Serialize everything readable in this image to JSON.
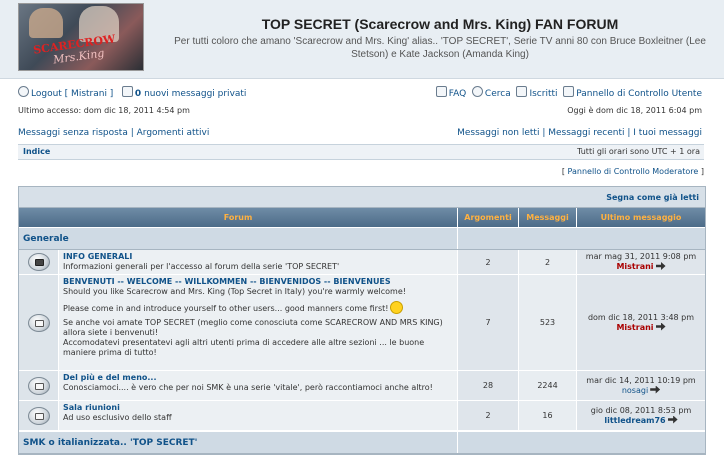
{
  "header": {
    "title": "TOP SECRET (Scarecrow and Mrs. King) FAN FORUM",
    "description": "Per tutti coloro che amano 'Scarecrow and Mrs. King' alias.. 'TOP SECRET', Serie TV anni 80 con Bruce Boxleitner (Lee Stetson) e Kate Jackson (Amanda King)",
    "logo_text_1": "SCARECROW",
    "logo_text_2": "Mrs.King"
  },
  "userbar": {
    "logout": "Logout [ Mistrani ]",
    "pm_count": "0",
    "pm_label": "nuovi messaggi privati",
    "faq": "FAQ",
    "search": "Cerca",
    "members": "Iscritti",
    "ucp": "Pannello di Controllo Utente",
    "last_visit": "Ultimo accesso: dom dic 18, 2011 4:54 pm",
    "current_time": "Oggi è dom dic 18, 2011 6:04 pm"
  },
  "quicklinks": {
    "unanswered": "Messaggi senza risposta",
    "active": "Argomenti attivi",
    "unread": "Messaggi non letti",
    "new": "Messaggi recenti",
    "own": "I tuoi messaggi"
  },
  "navbar": {
    "index": "Indice",
    "timezone": "Tutti gli orari sono UTC + 1 ora"
  },
  "mcp_link": "Pannello di Controllo Moderatore",
  "table": {
    "mark_read": "Segna come già letti",
    "col_forum": "Forum",
    "col_topics": "Argomenti",
    "col_posts": "Messaggi",
    "col_last": "Ultimo messaggio",
    "categories": [
      {
        "name": "Generale",
        "forums": [
          {
            "name": "INFO GENERALI",
            "desc": "Informazioni generali per l'accesso al forum della serie 'TOP SECRET'",
            "topics": "2",
            "posts": "2",
            "last_date": "mar mag 31, 2011 9:08 pm",
            "last_author": "Mistrani"
          },
          {
            "name": "BENVENUTI -- WELCOME -- WILLKOMMEN -- BIENVENIDOS -- BIENVENUES",
            "desc1": "Should you like Scarecrow and Mrs. King (Top Secret in Italy) you're warmly welcome!",
            "desc2": "Please come in and introduce yourself to other users... good manners come first!",
            "desc3": "Se anche voi amate TOP SECRET (meglio come conosciuta come SCARECROW AND MRS KING) allora siete i benvenuti!",
            "desc4": "Accomodatevi presentatevi agli altri utenti prima di accedere alle altre sezioni ... le buone maniere prima di tutto!",
            "topics": "7",
            "posts": "523",
            "last_date": "dom dic 18, 2011 3:48 pm",
            "last_author": "Mistrani"
          },
          {
            "name": "Del più e del meno...",
            "desc": "Conosciamoci.... è vero che per noi SMK è una serie 'vitale', però raccontiamoci anche altro!",
            "topics": "28",
            "posts": "2244",
            "last_date": "mar dic 14, 2011 10:19 pm",
            "last_author": "nosagi"
          },
          {
            "name": "Sala riunioni",
            "desc": "Ad uso esclusivo dello staff",
            "topics": "2",
            "posts": "16",
            "last_date": "gio dic 08, 2011 8:53 pm",
            "last_author": "littledream76"
          }
        ]
      },
      {
        "name": "SMK o italianizzata.. 'TOP SECRET'"
      }
    ]
  }
}
